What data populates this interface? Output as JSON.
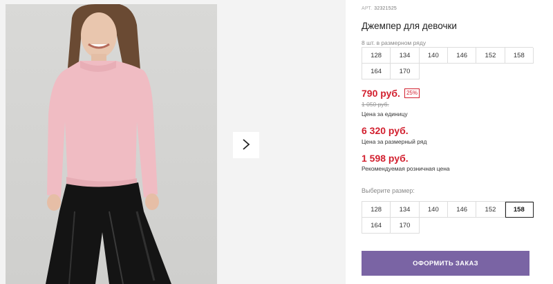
{
  "gallery": {
    "next_icon": "chevron-right-icon"
  },
  "product": {
    "sku_label": "АРТ.",
    "sku": "32321525",
    "title": "Джемпер для девочки",
    "pack_note": "8 шт. в размерном ряду",
    "pack_sizes": [
      "128",
      "134",
      "140",
      "146",
      "152",
      "158",
      "164",
      "170"
    ],
    "price": "790 руб.",
    "discount": "25%",
    "old_price": "1 050 руб.",
    "unit_label": "Цена за единицу",
    "set_price": "6 320 руб.",
    "set_label": "Цена за размерный ряд",
    "retail_price": "1 598 руб.",
    "retail_label": "Рекомендуемая розничная цена",
    "choose_label": "Выберите размер:",
    "choose_sizes": [
      "128",
      "134",
      "140",
      "146",
      "152",
      "158",
      "164",
      "170"
    ],
    "selected_size": "158",
    "order_label": "ОФОРМИТЬ ЗАКАЗ"
  },
  "colors": {
    "price": "#d21f2e",
    "button": "#7a64a4"
  }
}
